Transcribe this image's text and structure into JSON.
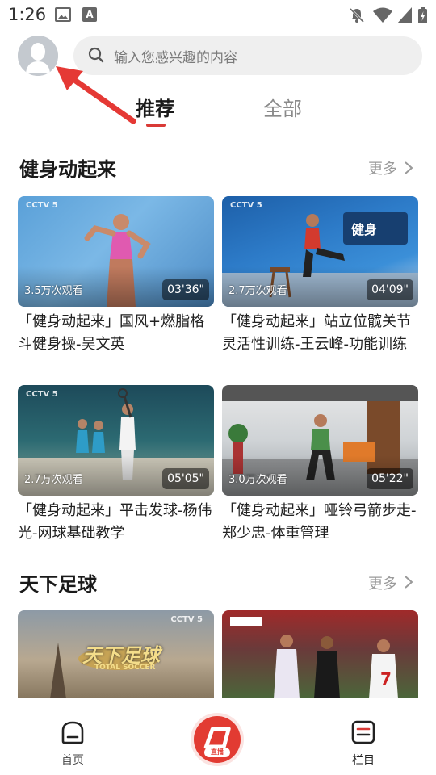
{
  "status_bar": {
    "time": "1:26",
    "a_badge": "A"
  },
  "search": {
    "placeholder": "输入您感兴趣的内容"
  },
  "tabs": [
    {
      "label": "推荐",
      "active": true
    },
    {
      "label": "全部",
      "active": false
    }
  ],
  "sections": [
    {
      "title": "健身动起来",
      "more_label": "更多",
      "cards": [
        {
          "title": "「健身动起来」国风+燃脂格斗健身操-吴文英",
          "views": "3.5万次观看",
          "duration": "03'36\"",
          "channel": "CCTV 5"
        },
        {
          "title": "「健身动起来」站立位髋关节灵活性训练-王云峰-功能训练",
          "views": "2.7万次观看",
          "duration": "04'09\"",
          "channel": "CCTV 5"
        },
        {
          "title": "「健身动起来」平击发球-杨伟光-网球基础教学",
          "views": "2.7万次观看",
          "duration": "05'05\"",
          "channel": "CCTV 5"
        },
        {
          "title": "「健身动起来」哑铃弓箭步走-郑少忠-体重管理",
          "views": "3.0万次观看",
          "duration": "05'22\"",
          "channel": ""
        }
      ]
    },
    {
      "title": "天下足球",
      "more_label": "更多",
      "cards": [
        {
          "title": "",
          "views": "",
          "duration": "",
          "channel": "CCTV 5",
          "overlay_text": "天下足球",
          "overlay_sub": "TOTAL SOCCER"
        },
        {
          "title": "",
          "views": "",
          "duration": "",
          "channel": ""
        }
      ]
    }
  ],
  "bottom_nav": {
    "home_label": "首页",
    "live_label": "直播",
    "columns_label": "栏目"
  },
  "colors": {
    "accent": "#d93a36",
    "live_red": "#e23b32",
    "arrow_red": "#e53935"
  }
}
